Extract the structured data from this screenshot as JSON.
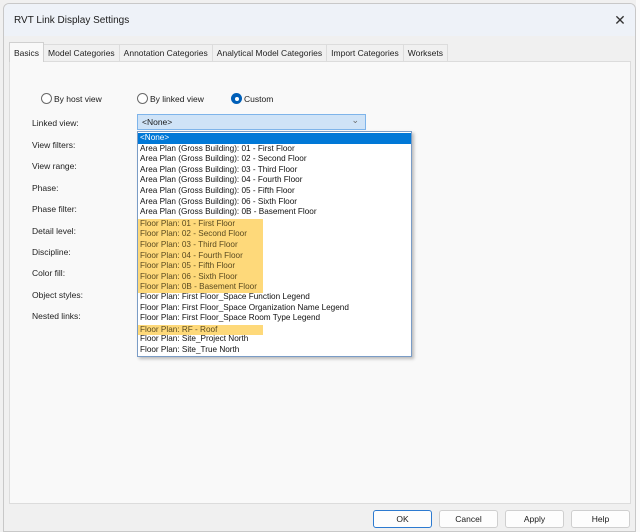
{
  "window": {
    "title": "RVT Link Display Settings",
    "close_icon": "close-icon"
  },
  "tabs": [
    {
      "label": "Basics",
      "active": true
    },
    {
      "label": "Model Categories",
      "active": false
    },
    {
      "label": "Annotation Categories",
      "active": false
    },
    {
      "label": "Analytical Model Categories",
      "active": false
    },
    {
      "label": "Import Categories",
      "active": false
    },
    {
      "label": "Worksets",
      "active": false
    }
  ],
  "basics": {
    "radios": [
      {
        "label": "By host view",
        "checked": false
      },
      {
        "label": "By linked view",
        "checked": false
      },
      {
        "label": "Custom",
        "checked": true
      }
    ],
    "labels": {
      "linked_view": "Linked view:",
      "view_filters": "View filters:",
      "view_range": "View range:",
      "phase": "Phase:",
      "phase_filter": "Phase filter:",
      "detail_level": "Detail level:",
      "discipline": "Discipline:",
      "color_fill": "Color fill:",
      "object_styles": "Object styles:",
      "nested_links": "Nested links:"
    },
    "linked_view": {
      "value": "<None>",
      "chevron": "chevron-down-icon",
      "options": [
        {
          "label": "<None>",
          "state": "selected"
        },
        {
          "label": "Area Plan (Gross Building): 01 - First Floor",
          "state": "normal"
        },
        {
          "label": "Area Plan (Gross Building): 02 - Second Floor",
          "state": "normal"
        },
        {
          "label": "Area Plan (Gross Building): 03 - Third Floor",
          "state": "normal"
        },
        {
          "label": "Area Plan (Gross Building): 04 - Fourth Floor",
          "state": "normal"
        },
        {
          "label": "Area Plan (Gross Building): 05 - Fifth Floor",
          "state": "normal"
        },
        {
          "label": "Area Plan (Gross Building): 06 - Sixth Floor",
          "state": "normal"
        },
        {
          "label": "Area Plan (Gross Building): 0B - Basement Floor",
          "state": "normal"
        },
        {
          "label": "Floor Plan: 01 - First Floor",
          "state": "highlighted"
        },
        {
          "label": "Floor Plan: 02 - Second Floor",
          "state": "highlighted"
        },
        {
          "label": "Floor Plan: 03 - Third Floor",
          "state": "highlighted"
        },
        {
          "label": "Floor Plan: 04 - Fourth Floor",
          "state": "highlighted"
        },
        {
          "label": "Floor Plan: 05 - Fifth Floor",
          "state": "highlighted"
        },
        {
          "label": "Floor Plan: 06 - Sixth Floor",
          "state": "highlighted"
        },
        {
          "label": "Floor Plan: 0B - Basement Floor",
          "state": "highlighted"
        },
        {
          "label": "Floor Plan: First Floor_Space Function Legend",
          "state": "normal"
        },
        {
          "label": "Floor Plan: First Floor_Space Organization Name Legend",
          "state": "normal"
        },
        {
          "label": "Floor Plan: First Floor_Space Room Type Legend",
          "state": "normal"
        },
        {
          "label": "Floor Plan: RF - Roof",
          "state": "highlighted"
        },
        {
          "label": "Floor Plan: Site_Project North",
          "state": "normal"
        },
        {
          "label": "Floor Plan: Site_True North",
          "state": "normal"
        }
      ]
    }
  },
  "footer": {
    "ok": "OK",
    "cancel": "Cancel",
    "apply": "Apply",
    "help": "Help"
  },
  "colors": {
    "accent": "#0078d7",
    "highlight": "#fed97a",
    "combo_bg": "#cfe3f7"
  }
}
